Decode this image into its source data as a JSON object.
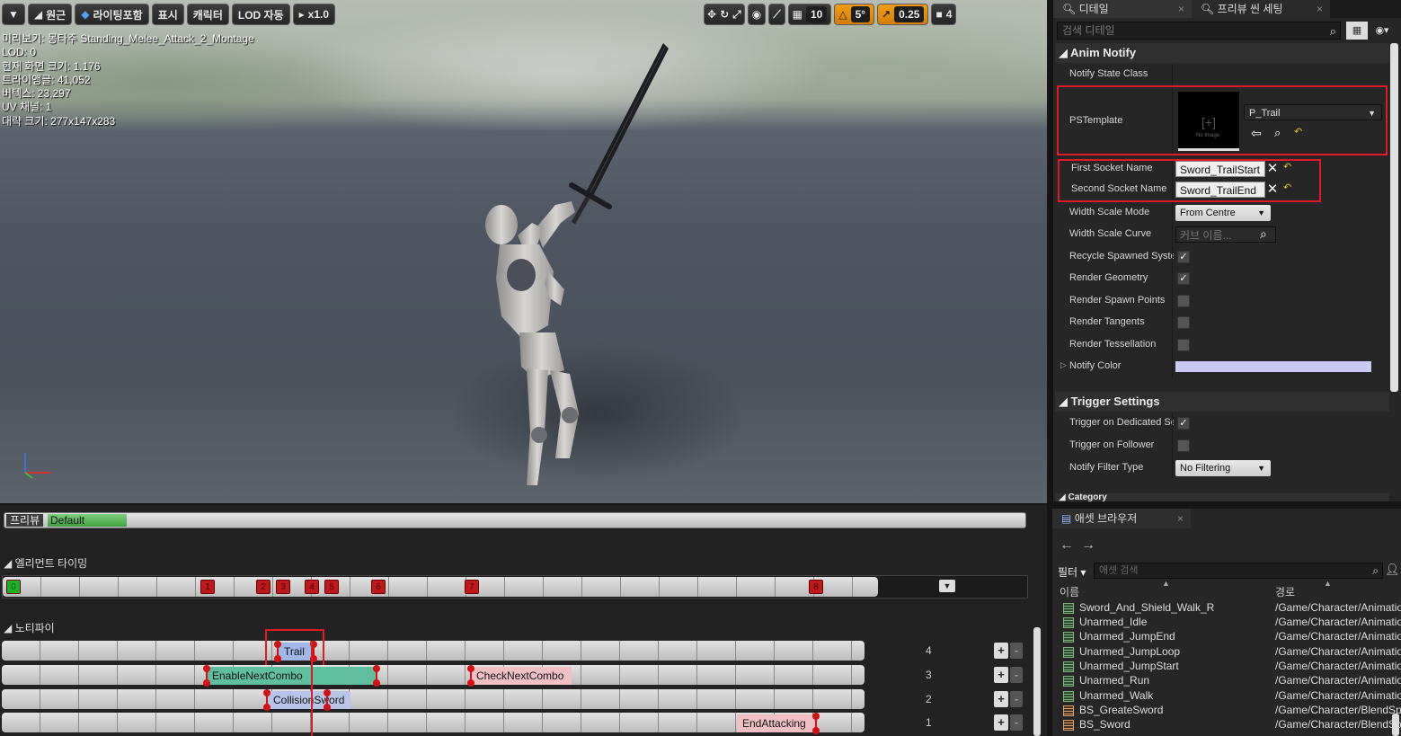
{
  "toolbar": {
    "perspective_label": "원근",
    "lighting_label": "라이팅포함",
    "show_label": "표시",
    "character_label": "캐릭터",
    "lod_label": "LOD 자동",
    "speed_label": "x1.0",
    "grid_snap_value": "10",
    "rotation_snap_value": "5°",
    "scale_snap_value": "0.25",
    "camera_speed_value": "4"
  },
  "stats": {
    "lines": [
      "미리보기: 몽타주 Standing_Melee_Attack_2_Montage",
      "LOD: 0",
      "현재 화면 크기: 1.176",
      "트라이앵글: 41,052",
      "버텍스: 23,297",
      "UV 채널: 1",
      "대략 크기: 277x147x283"
    ]
  },
  "timeline": {
    "preview_label": "프리뷰",
    "preview_slot": "Default",
    "element_timing_label": "◢ 엘리먼트 타이밍",
    "notifies_label": "◢ 노티파이",
    "timing_markers": [
      "0",
      "1",
      "2",
      "3",
      "4",
      "5",
      "6",
      "7",
      "8"
    ],
    "lanes": [
      {
        "number": "4",
        "notifies": [
          "Trail"
        ]
      },
      {
        "number": "3",
        "notifies": [
          "EnableNextCombo",
          "CheckNextCombo"
        ]
      },
      {
        "number": "2",
        "notifies": [
          "CollisionSword"
        ]
      },
      {
        "number": "1",
        "notifies": [
          "EndAttacking"
        ]
      }
    ],
    "add_label": "+",
    "remove_label": "-"
  },
  "details": {
    "tab_details": "디테일",
    "tab_preview": "프리뷰 씬 세팅",
    "search_placeholder": "검색 디테일",
    "anim_notify_header": "◢ Anim Notify",
    "notify_state_class_label": "Notify State Class",
    "pstemplate_label": "PSTemplate",
    "pstemplate_value": "P_Trail",
    "no_image_label": "No Image",
    "first_socket_label": "First Socket Name",
    "first_socket_value": "Sword_TrailStart",
    "second_socket_label": "Second Socket Name",
    "second_socket_value": "Sword_TrailEnd",
    "width_scale_mode_label": "Width Scale Mode",
    "width_scale_mode_value": "From Centre",
    "width_scale_curve_label": "Width Scale Curve",
    "width_scale_curve_placeholder": "커브 이름...",
    "recycle_label": "Recycle Spawned Systems",
    "render_geometry_label": "Render Geometry",
    "render_spawn_points_label": "Render Spawn Points",
    "render_tangents_label": "Render Tangents",
    "render_tessellation_label": "Render Tessellation",
    "notify_color_label": "Notify Color",
    "notify_color_hex": "#c9c9f2",
    "trigger_settings_header": "◢ Trigger Settings",
    "trigger_dedicated_label": "Trigger on Dedicated Server",
    "trigger_follower_label": "Trigger on Follower",
    "notify_filter_type_label": "Notify Filter Type",
    "notify_filter_type_value": "No Filtering",
    "category_header": "◢ Category"
  },
  "assets": {
    "tab_label": "애셋 브라우저",
    "filter_label": "필터 ▾",
    "search_placeholder": "애셋 검색",
    "col_name": "이름",
    "col_path": "경로",
    "rows": [
      {
        "name": "Sword_And_Shield_Walk_R",
        "path": "/Game/Character/Animations",
        "kind": "anim"
      },
      {
        "name": "Unarmed_Idle",
        "path": "/Game/Character/Animations",
        "kind": "anim"
      },
      {
        "name": "Unarmed_JumpEnd",
        "path": "/Game/Character/Animations",
        "kind": "anim"
      },
      {
        "name": "Unarmed_JumpLoop",
        "path": "/Game/Character/Animations",
        "kind": "anim"
      },
      {
        "name": "Unarmed_JumpStart",
        "path": "/Game/Character/Animations",
        "kind": "anim"
      },
      {
        "name": "Unarmed_Run",
        "path": "/Game/Character/Animations",
        "kind": "anim"
      },
      {
        "name": "Unarmed_Walk",
        "path": "/Game/Character/Animations",
        "kind": "anim"
      },
      {
        "name": "BS_GreateSword",
        "path": "/Game/Character/BlendSpaces",
        "kind": "bs"
      },
      {
        "name": "BS_Sword",
        "path": "/Game/Character/BlendSpaces",
        "kind": "bs"
      }
    ]
  },
  "colors": {
    "highlight_red": "#e01b24",
    "orange_toolbar": "#f39c12",
    "notify_green": "#5fbf9f",
    "notify_pink": "#f0c0c4"
  }
}
